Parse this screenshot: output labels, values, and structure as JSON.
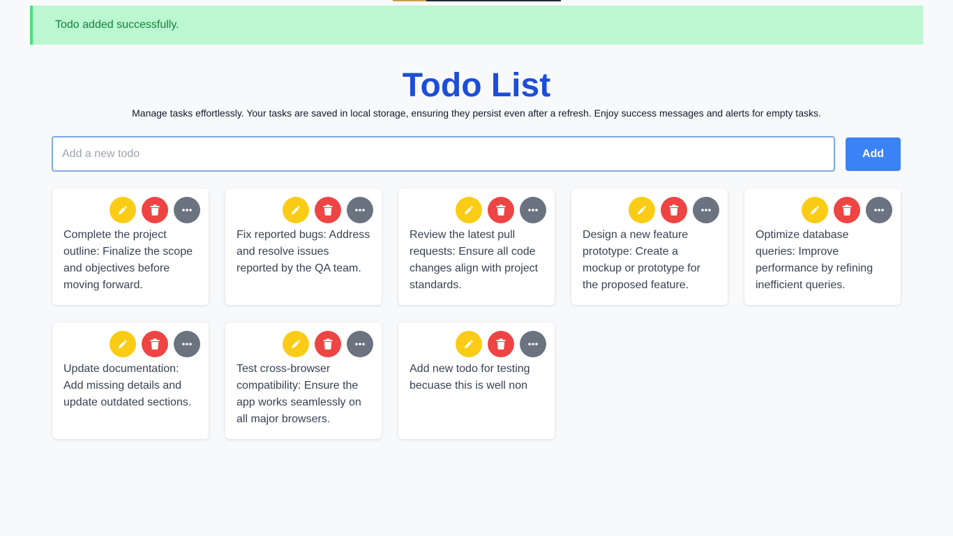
{
  "alert": {
    "message": "Todo added successfully."
  },
  "header": {
    "title": "Todo List",
    "subtitle": "Manage tasks effortlessly. Your tasks are saved in local storage, ensuring they persist even after a refresh. Enjoy success messages and alerts for empty tasks."
  },
  "form": {
    "placeholder": "Add a new todo",
    "value": "",
    "add_label": "Add"
  },
  "todos": [
    {
      "text": "Complete the project outline: Finalize the scope and objectives before moving forward."
    },
    {
      "text": "Fix reported bugs: Address and resolve issues reported by the QA team."
    },
    {
      "text": "Review the latest pull requests: Ensure all code changes align with project standards."
    },
    {
      "text": "Design a new feature prototype: Create a mockup or prototype for the proposed feature."
    },
    {
      "text": "Optimize database queries: Improve performance by refining inefficient queries."
    },
    {
      "text": "Update documentation: Add missing details and update outdated sections."
    },
    {
      "text": "Test cross-browser compatibility: Ensure the app works seamlessly on all major browsers."
    },
    {
      "text": "Add new todo for testing becuase this is well non"
    }
  ],
  "icons": {
    "edit": "pencil-icon",
    "delete": "trash-icon",
    "more": "more-dots-icon"
  },
  "colors": {
    "accent": "#3b82f6",
    "title": "#1d4ed8",
    "success_bg": "#bbf7d0",
    "success_text": "#15803d",
    "edit": "#facc15",
    "delete": "#ef4444",
    "more": "#6b7280"
  }
}
